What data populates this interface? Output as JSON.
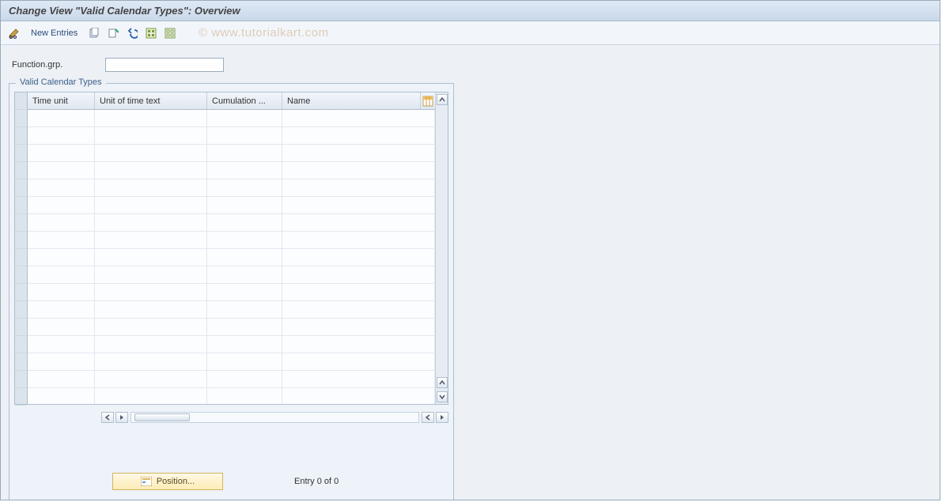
{
  "title": "Change View \"Valid Calendar Types\": Overview",
  "watermark": "© www.tutorialkart.com",
  "toolbar": {
    "new_entries_label": "New Entries"
  },
  "form": {
    "function_grp_label": "Function.grp.",
    "function_grp_value": ""
  },
  "panel": {
    "title": "Valid Calendar Types",
    "columns": [
      "Time unit",
      "Unit of time text",
      "Cumulation ...",
      "Name"
    ],
    "rows": [
      [
        "",
        "",
        "",
        ""
      ],
      [
        "",
        "",
        "",
        ""
      ],
      [
        "",
        "",
        "",
        ""
      ],
      [
        "",
        "",
        "",
        ""
      ],
      [
        "",
        "",
        "",
        ""
      ],
      [
        "",
        "",
        "",
        ""
      ],
      [
        "",
        "",
        "",
        ""
      ],
      [
        "",
        "",
        "",
        ""
      ],
      [
        "",
        "",
        "",
        ""
      ],
      [
        "",
        "",
        "",
        ""
      ],
      [
        "",
        "",
        "",
        ""
      ],
      [
        "",
        "",
        "",
        ""
      ],
      [
        "",
        "",
        "",
        ""
      ],
      [
        "",
        "",
        "",
        ""
      ],
      [
        "",
        "",
        "",
        ""
      ],
      [
        "",
        "",
        "",
        ""
      ],
      [
        "",
        "",
        "",
        ""
      ]
    ],
    "position_label": "Position...",
    "entry_text": "Entry 0 of 0"
  },
  "colors": {
    "accent": "#3b5f8a",
    "panel_bg": "#edf1f6"
  }
}
